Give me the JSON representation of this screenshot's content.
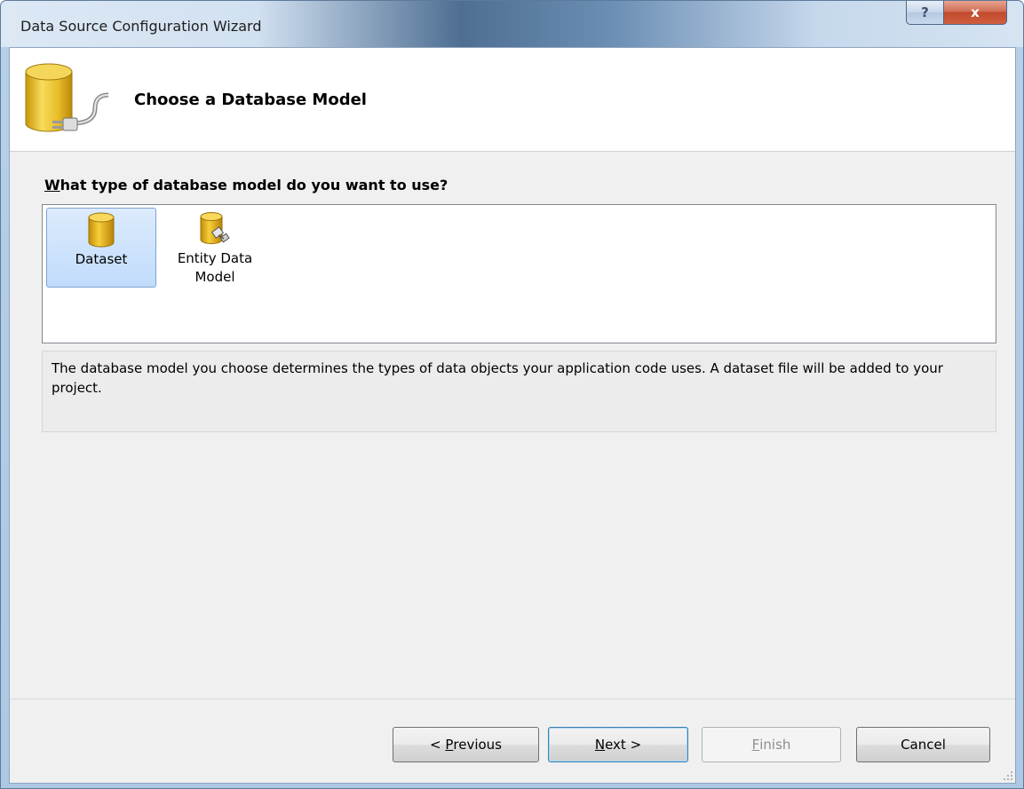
{
  "window": {
    "title": "Data Source Configuration Wizard",
    "help_glyph": "?",
    "close_glyph": "x"
  },
  "header": {
    "title": "Choose a Database Model",
    "icon": "database-plug-icon"
  },
  "question": {
    "accel": "W",
    "rest": "hat type of database model do you want to use?"
  },
  "models": [
    {
      "label": "Dataset",
      "icon": "dataset-cylinder-icon",
      "selected": true
    },
    {
      "label": "Entity Data Model",
      "icon": "entity-data-model-icon",
      "selected": false
    }
  ],
  "description": "The database model you choose determines the types of data objects your application code uses. A dataset file will be added to your project.",
  "buttons": {
    "previous": {
      "prefix": "< ",
      "accel": "P",
      "rest": "revious"
    },
    "next": {
      "prefix": "",
      "accel": "N",
      "rest": "ext >"
    },
    "finish": {
      "prefix": "",
      "accel": "F",
      "rest": "inish",
      "disabled": true
    },
    "cancel": {
      "label": "Cancel"
    }
  },
  "colors": {
    "selection": "#c1dcfc",
    "cylinder": "#e3b520",
    "close_button": "#c24a2d"
  }
}
